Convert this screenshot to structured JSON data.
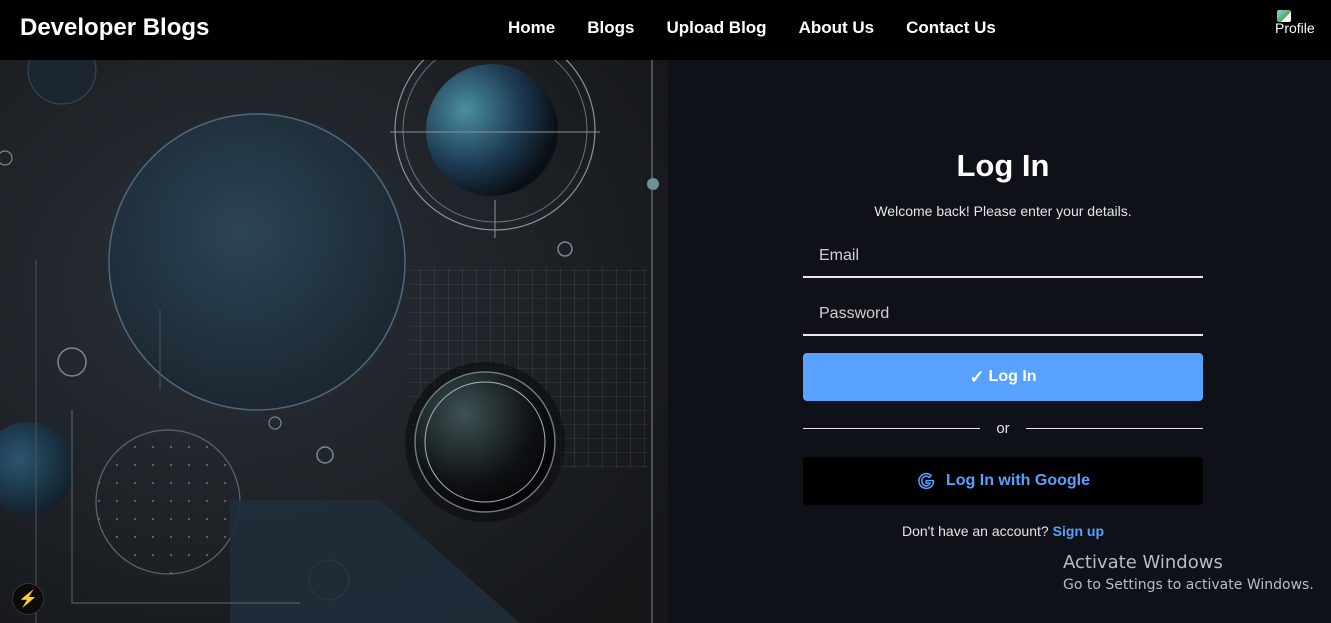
{
  "header": {
    "brand": "Developer Blogs",
    "nav": [
      "Home",
      "Blogs",
      "Upload Blog",
      "About Us",
      "Contact Us"
    ],
    "profile_alt": "Profile"
  },
  "login": {
    "title": "Log In",
    "subtitle": "Welcome back! Please enter your details.",
    "email_placeholder": "Email",
    "password_placeholder": "Password",
    "login_button": "Log In",
    "or": "or",
    "google_button": "Log In with Google",
    "signup_prompt": "Don't have an account?",
    "signup_link": "Sign up"
  },
  "watermark": {
    "line1": "Activate Windows",
    "line2": "Go to Settings to activate Windows."
  },
  "colors": {
    "accent": "#58a1ff",
    "topbar": "#000000",
    "panel_bg": "#0e1117"
  },
  "icons": {
    "check": "check-icon",
    "google": "google-icon",
    "bolt": "lightning-bolt-icon",
    "profile": "profile-image-icon"
  }
}
